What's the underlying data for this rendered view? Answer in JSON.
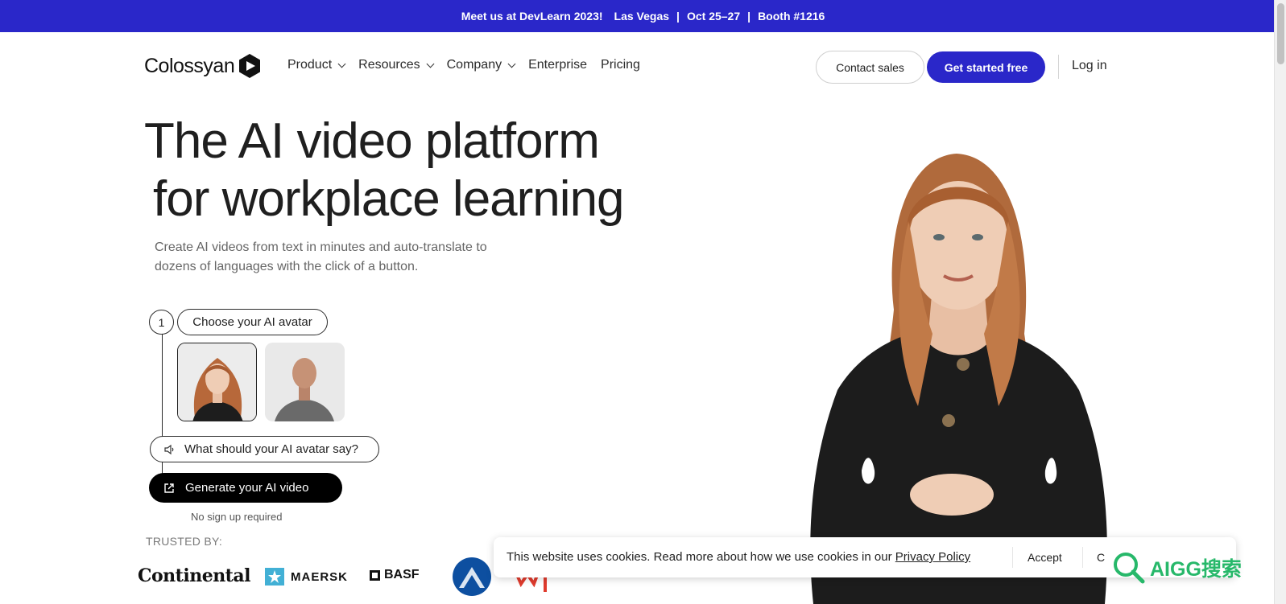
{
  "announcement": {
    "part1": "Meet us at DevLearn 2023!",
    "part2": "Las Vegas",
    "sep1": "|",
    "part3": "Oct 25–27",
    "sep2": "|",
    "part4": "Booth #1216",
    "background": "#2a27c9"
  },
  "nav": {
    "logo_text": "Colossyan",
    "items": [
      {
        "label": "Product",
        "has_dropdown": true
      },
      {
        "label": "Resources",
        "has_dropdown": true
      },
      {
        "label": "Company",
        "has_dropdown": true
      },
      {
        "label": "Enterprise",
        "has_dropdown": false
      },
      {
        "label": "Pricing",
        "has_dropdown": false
      }
    ],
    "contact_label": "Contact sales",
    "get_started_label": "Get started free",
    "login_label": "Log in"
  },
  "hero": {
    "title_line1": "The AI video platform",
    "title_line2": "for workplace learning",
    "subtitle": "Create AI videos from text in minutes and auto-translate to dozens of languages with the click of a button.",
    "step_number": "1",
    "choose_avatar_label": "Choose your AI avatar",
    "say_label": "What should your AI avatar say?",
    "generate_label": "Generate your AI video",
    "no_signup": "No sign up required",
    "trusted_by": "TRUSTED BY:"
  },
  "logos": {
    "continental": "Continental",
    "maersk": "MAERSK",
    "basf": "BASF"
  },
  "cookie": {
    "text": "This website uses cookies. Read more about how we use cookies in our",
    "link": "Privacy Policy",
    "accept": "Accept",
    "close": "C"
  },
  "watermark": {
    "text": "AIGG搜索"
  },
  "colors": {
    "brand": "#2a27c9",
    "text": "#1f1f1f",
    "watermark": "#27b86a"
  }
}
